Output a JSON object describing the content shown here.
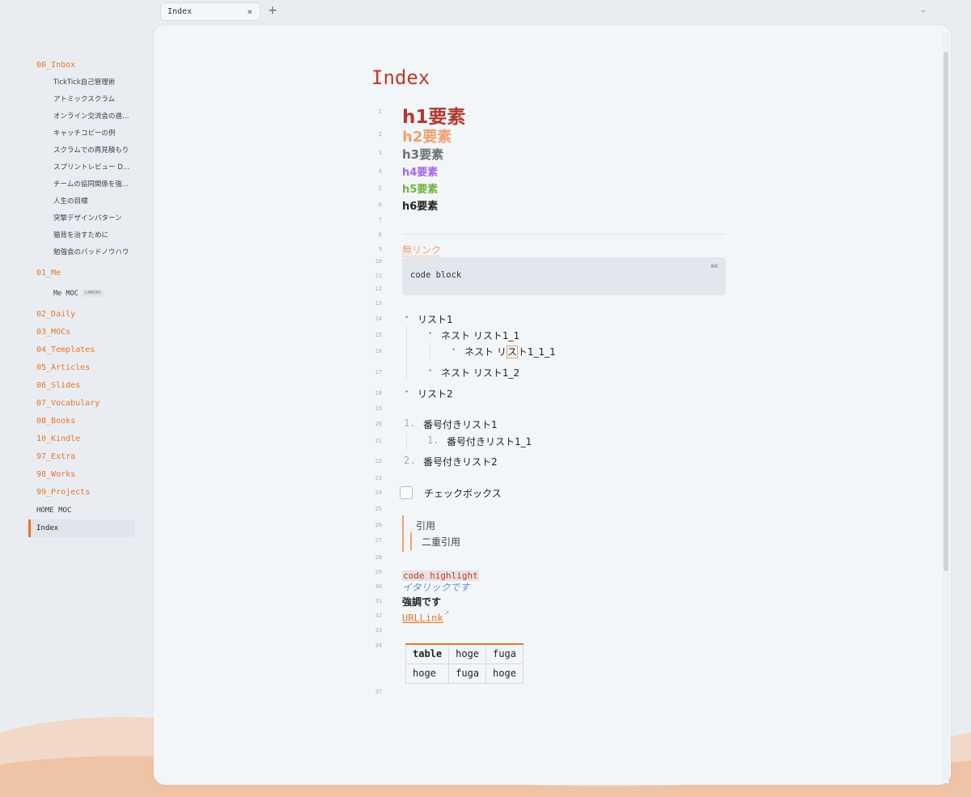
{
  "tabs": {
    "active_label": "Index",
    "close_glyph": "×",
    "new_tab_glyph": "+",
    "dropdown_glyph": "⌄"
  },
  "sidebar": {
    "folder_00": "00_Inbox",
    "inbox_files": [
      "TickTick自己管理術",
      "アトミックスクラム",
      "オンライン交流会の進…",
      "キャッチコピーの例",
      "スクラムでの再見積もり",
      "スプリントレビュー D…",
      "チームの協同関係を強…",
      "人生の目標",
      "突撃デザインパターン",
      "猫背を治すために",
      "勉強会のバッドノウハウ"
    ],
    "folder_01": "01_Me",
    "me_file": "Me MOC",
    "canvas_badge": "CANVAS",
    "folders": [
      "02_Daily",
      "03_MOCs",
      "04_Templates",
      "05_Articles",
      "06_Slides",
      "07_Vocabulary",
      "08_Books",
      "10_Kindle",
      "97_Extra",
      "98_Works",
      "99_Projects"
    ],
    "home_moc": "HOME MOC",
    "active_file": "Index"
  },
  "doc": {
    "title": "Index",
    "h1": "h1要素",
    "h2": "h2要素",
    "h3": "h3要素",
    "h4": "h4要素",
    "h5": "h5要素",
    "h6": "h6要素",
    "no_link": "無リンク",
    "code_block": "code block",
    "code_lang": "md",
    "list1": "リスト1",
    "nest1_1": "ネスト リスト1_1",
    "nest1_1_1_a": "ネスト リ",
    "nest1_1_1_b": "ス",
    "nest1_1_1_c": "ト1_1_1",
    "nest1_2": "ネスト リスト1_2",
    "list2": "リスト2",
    "ol1_num": "1.",
    "ol1": "番号付きリスト1",
    "ol1_1_num": "1.",
    "ol1_1": "番号付きリスト1_1",
    "ol2_num": "2.",
    "ol2": "番号付きリスト2",
    "checkbox": "チェックボックス",
    "quote1": "引用",
    "quote2": "二重引用",
    "code_highlight": "code highlight",
    "italic": "イタリックです",
    "bold": "強調です",
    "url_link": "URLLink",
    "table": [
      [
        "table",
        "hoge",
        "fuga"
      ],
      [
        "hoge",
        "fuga",
        "hoge"
      ]
    ],
    "line_numbers": [
      "1",
      "2",
      "3",
      "4",
      "5",
      "6",
      "7",
      "8",
      "9",
      "10",
      "11",
      "12",
      "13",
      "14",
      "15",
      "16",
      "17",
      "18",
      "19",
      "20",
      "21",
      "22",
      "23",
      "24",
      "25",
      "26",
      "27",
      "28",
      "29",
      "30",
      "31",
      "32",
      "33",
      "34",
      "37"
    ]
  }
}
